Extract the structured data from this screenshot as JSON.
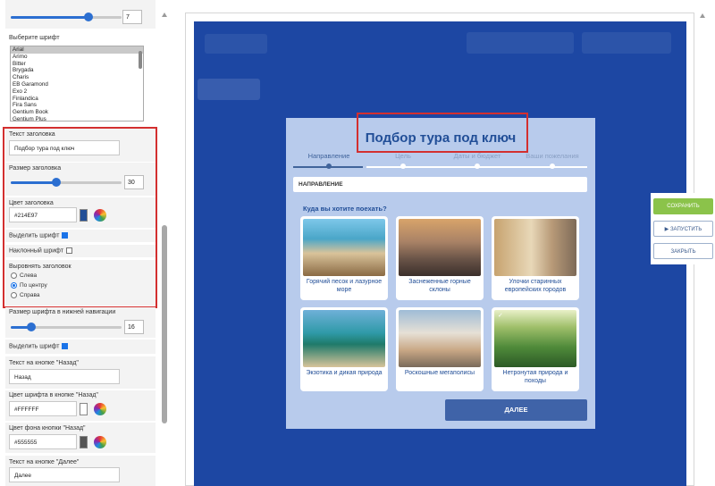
{
  "left_panel": {
    "top_slider_value": "7",
    "font_select_label": "Выберите шрифт",
    "font_options": [
      "Arial",
      "Arimo",
      "Bitter",
      "Brygada",
      "Charis",
      "EB Garamond",
      "Exo 2",
      "Finlandica",
      "Fira Sans",
      "Gentium Book",
      "Gentium Plus"
    ],
    "font_selected": "Arial",
    "header_text_label": "Текст заголовка",
    "header_text_value": "Подбор тура под ключ",
    "header_size_label": "Размер заголовка",
    "header_size_value": "30",
    "header_color_label": "Цвет заголовка",
    "header_color_value": "#214E97",
    "bold_label": "Выделить шрифт",
    "italic_label": "Наклонный шрифт",
    "align_label": "Выровнять заголовок",
    "align_options": [
      "Слева",
      "По центру",
      "Справа"
    ],
    "align_selected": "По центру",
    "nav_font_size_label": "Размер шрифта в нижней навигации",
    "nav_font_size_value": "16",
    "bold2_label": "Выделить шрифт",
    "back_btn_text_label": "Текст на кнопке \"Назад\"",
    "back_btn_text_value": "Назад",
    "back_font_color_label": "Цвет шрифта в кнопке \"Назад\"",
    "back_font_color_value": "#FFFFFF",
    "back_bg_color_label": "Цвет фона кнопки \"Назад\"",
    "back_bg_color_value": "#555555",
    "next_btn_text_label": "Текст на кнопке \"Далее\"",
    "next_btn_text_value": "Далее"
  },
  "quiz": {
    "title": "Подбор тура под ключ",
    "steps": [
      "Направление",
      "Цель",
      "Даты и бюджет",
      "Ваши пожелания"
    ],
    "section_label": "НАПРАВЛЕНИЕ",
    "question": "Куда вы хотите поехать?",
    "options": [
      {
        "label": "Горячий песок и лазурное море",
        "selected": false
      },
      {
        "label": "Заснеженные горные склоны",
        "selected": false
      },
      {
        "label": "Улочки старинных европейских городов",
        "selected": false
      },
      {
        "label": "Экзотика и дикая природа",
        "selected": false
      },
      {
        "label": "Роскошные мегаполисы",
        "selected": false
      },
      {
        "label": "Нетронутая природа и походы",
        "selected": true
      }
    ],
    "next_label": "ДАЛЕЕ",
    "check_icon": "✓"
  },
  "actions": {
    "save": "СОХРАНИТЬ",
    "run": "ЗАПУСТИТЬ",
    "close": "ЗАКРЫТЬ",
    "run_icon": "▶"
  },
  "colors": {
    "title": "#214E97",
    "overlay": "#1d47a3",
    "modal_bg": "#b8cbec",
    "next_button": "#3f63a8",
    "save_button": "#8bc34a",
    "highlight": "#d32f2f"
  }
}
